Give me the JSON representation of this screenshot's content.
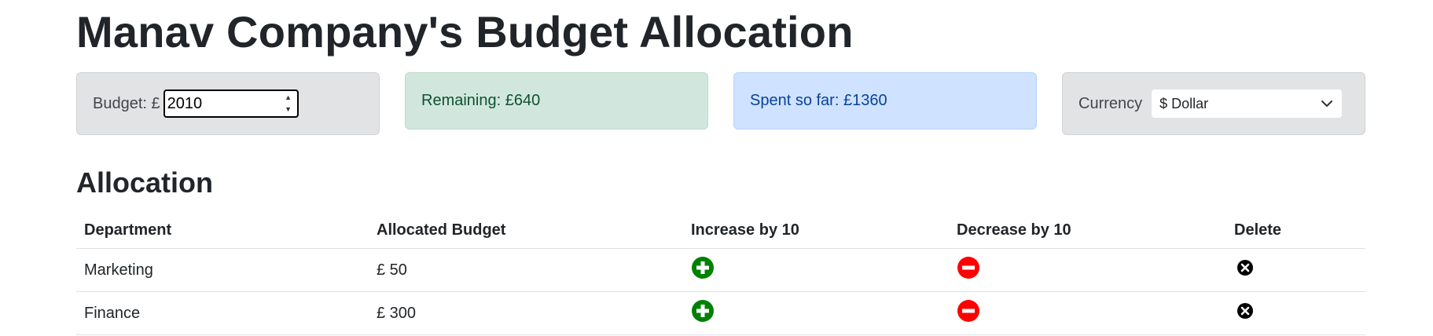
{
  "page": {
    "title": "Manav Company's Budget Allocation"
  },
  "budget": {
    "label": "Budget: £",
    "value": "2010"
  },
  "remaining": {
    "text": "Remaining: £640"
  },
  "spent": {
    "text": "Spent so far: £1360"
  },
  "currency": {
    "label": "Currency",
    "selected": "$ Dollar"
  },
  "allocation": {
    "heading": "Allocation",
    "columns": [
      "Department",
      "Allocated Budget",
      "Increase by 10",
      "Decrease by 10",
      "Delete"
    ],
    "rows": [
      {
        "department": "Marketing",
        "allocated": "£ 50"
      },
      {
        "department": "Finance",
        "allocated": "£ 300"
      }
    ]
  },
  "colors": {
    "increase": "#008000",
    "decrease": "#ff0000",
    "delete": "#000000"
  },
  "icons": {
    "increase": "plus-circle-icon",
    "decrease": "minus-circle-icon",
    "delete": "x-circle-icon"
  }
}
